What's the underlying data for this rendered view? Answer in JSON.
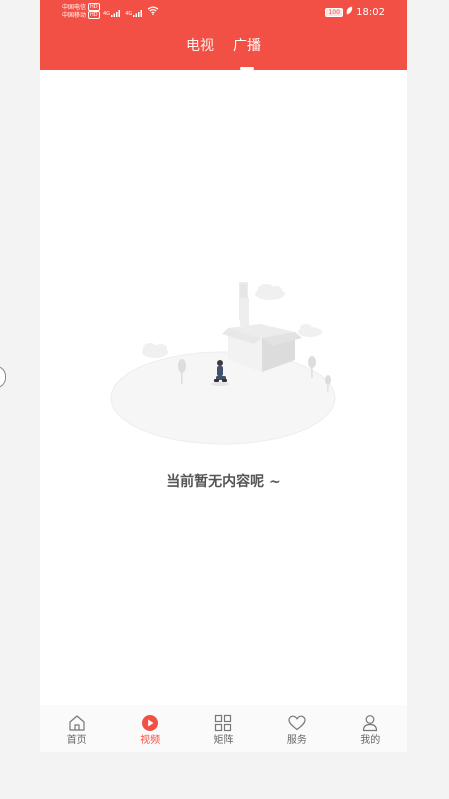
{
  "statusbar": {
    "carrier1": "中国电信",
    "carrier2": "中国移动",
    "hd": "HD",
    "signal_label_1": "4G",
    "signal_label_2": "4G",
    "battery": "100",
    "time": "18:02"
  },
  "header": {
    "tabs": [
      {
        "label": "电视",
        "active": false
      },
      {
        "label": "广播",
        "active": true
      }
    ]
  },
  "empty_state": {
    "message": "当前暂无内容呢 ~"
  },
  "tabbar": {
    "items": [
      {
        "label": "首页",
        "icon": "home-icon",
        "active": false
      },
      {
        "label": "视频",
        "icon": "play-icon",
        "active": true
      },
      {
        "label": "矩阵",
        "icon": "grid-icon",
        "active": false
      },
      {
        "label": "服务",
        "icon": "heart-icon",
        "active": false
      },
      {
        "label": "我的",
        "icon": "user-icon",
        "active": false
      }
    ]
  },
  "colors": {
    "brand": "#f25044",
    "inactive_text": "#666666"
  }
}
